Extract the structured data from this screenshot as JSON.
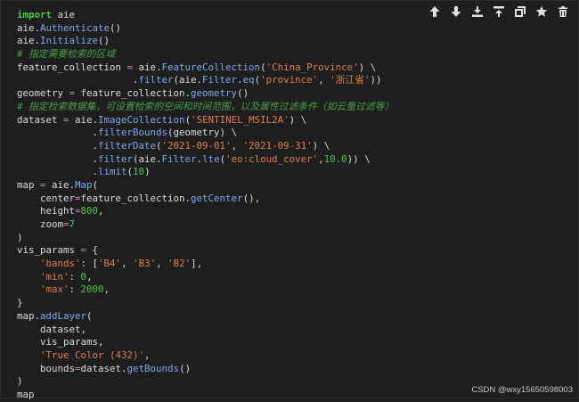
{
  "toolbar": {
    "buttons": [
      {
        "name": "move-up-button",
        "icon": "arrow-up-icon"
      },
      {
        "name": "move-down-button",
        "icon": "arrow-down-icon"
      },
      {
        "name": "insert-above-button",
        "icon": "insert-above-icon"
      },
      {
        "name": "insert-below-button",
        "icon": "insert-below-icon"
      },
      {
        "name": "duplicate-button",
        "icon": "duplicate-icon"
      },
      {
        "name": "bookmark-button",
        "icon": "star-icon"
      },
      {
        "name": "delete-button",
        "icon": "trash-icon"
      }
    ]
  },
  "code": {
    "lines": [
      [
        [
          "kw",
          "import"
        ],
        [
          "nm",
          " aie"
        ]
      ],
      [
        [
          "nm",
          "aie."
        ],
        [
          "at",
          "Authenticate"
        ],
        [
          "nm",
          "()"
        ]
      ],
      [
        [
          "nm",
          "aie."
        ],
        [
          "at",
          "Initialize"
        ],
        [
          "nm",
          "()"
        ]
      ],
      [
        [
          "cm",
          "# 指定需要检索的区域"
        ]
      ],
      [
        [
          "nm",
          "feature_collection "
        ],
        [
          "op",
          "="
        ],
        [
          "nm",
          " aie."
        ],
        [
          "at",
          "FeatureCollection"
        ],
        [
          "nm",
          "("
        ],
        [
          "st",
          "'China_Province'"
        ],
        [
          "nm",
          ") \\"
        ]
      ],
      [
        [
          "nm",
          "                    ."
        ],
        [
          "at",
          "filter"
        ],
        [
          "nm",
          "(aie."
        ],
        [
          "at",
          "Filter"
        ],
        [
          "nm",
          "."
        ],
        [
          "at",
          "eq"
        ],
        [
          "nm",
          "("
        ],
        [
          "st",
          "'province'"
        ],
        [
          "nm",
          ", "
        ],
        [
          "st",
          "'浙江省'"
        ],
        [
          "nm",
          "))"
        ]
      ],
      [
        [
          "nm",
          "geometry "
        ],
        [
          "op",
          "="
        ],
        [
          "nm",
          " feature_collection."
        ],
        [
          "at",
          "geometry"
        ],
        [
          "nm",
          "()"
        ]
      ],
      [
        [
          "cm",
          "# 指定检索数据集，可设置检索的空间和时间范围，以及属性过滤条件（如云量过滤等）"
        ]
      ],
      [
        [
          "nm",
          "dataset "
        ],
        [
          "op",
          "="
        ],
        [
          "nm",
          " aie."
        ],
        [
          "at",
          "ImageCollection"
        ],
        [
          "nm",
          "("
        ],
        [
          "st",
          "'SENTINEL_MSIL2A'"
        ],
        [
          "nm",
          ") \\"
        ]
      ],
      [
        [
          "nm",
          "             ."
        ],
        [
          "at",
          "filterBounds"
        ],
        [
          "nm",
          "(geometry) \\"
        ]
      ],
      [
        [
          "nm",
          "             ."
        ],
        [
          "at",
          "filterDate"
        ],
        [
          "nm",
          "("
        ],
        [
          "st",
          "'2021-09-01'"
        ],
        [
          "nm",
          ", "
        ],
        [
          "st",
          "'2021-09-31'"
        ],
        [
          "nm",
          ") \\"
        ]
      ],
      [
        [
          "nm",
          "             ."
        ],
        [
          "at",
          "filter"
        ],
        [
          "nm",
          "(aie."
        ],
        [
          "at",
          "Filter"
        ],
        [
          "nm",
          "."
        ],
        [
          "at",
          "lte"
        ],
        [
          "nm",
          "("
        ],
        [
          "st",
          "'eo:cloud_cover'"
        ],
        [
          "nm",
          ","
        ],
        [
          "nu",
          "10.0"
        ],
        [
          "nm",
          ")) \\"
        ]
      ],
      [
        [
          "nm",
          "             ."
        ],
        [
          "at",
          "limit"
        ],
        [
          "nm",
          "("
        ],
        [
          "nu",
          "10"
        ],
        [
          "nm",
          ")"
        ]
      ],
      [
        [
          "nm",
          "map "
        ],
        [
          "op",
          "="
        ],
        [
          "nm",
          " aie."
        ],
        [
          "at",
          "Map"
        ],
        [
          "nm",
          "("
        ]
      ],
      [
        [
          "nm",
          "    center"
        ],
        [
          "op",
          "="
        ],
        [
          "nm",
          "feature_collection."
        ],
        [
          "at",
          "getCenter"
        ],
        [
          "nm",
          "(),"
        ]
      ],
      [
        [
          "nm",
          "    height"
        ],
        [
          "op",
          "="
        ],
        [
          "nu",
          "800"
        ],
        [
          "nm",
          ","
        ]
      ],
      [
        [
          "nm",
          "    zoom"
        ],
        [
          "op",
          "="
        ],
        [
          "nu",
          "7"
        ]
      ],
      [
        [
          "nm",
          ")"
        ]
      ],
      [
        [
          "nm",
          "vis_params "
        ],
        [
          "op",
          "="
        ],
        [
          "nm",
          " {"
        ]
      ],
      [
        [
          "nm",
          "    "
        ],
        [
          "st",
          "'bands'"
        ],
        [
          "nm",
          ": ["
        ],
        [
          "st",
          "'B4'"
        ],
        [
          "nm",
          ", "
        ],
        [
          "st",
          "'B3'"
        ],
        [
          "nm",
          ", "
        ],
        [
          "st",
          "'B2'"
        ],
        [
          "nm",
          "],"
        ]
      ],
      [
        [
          "nm",
          "    "
        ],
        [
          "st",
          "'min'"
        ],
        [
          "nm",
          ": "
        ],
        [
          "nu",
          "0"
        ],
        [
          "nm",
          ","
        ]
      ],
      [
        [
          "nm",
          "    "
        ],
        [
          "st",
          "'max'"
        ],
        [
          "nm",
          ": "
        ],
        [
          "nu",
          "2000"
        ],
        [
          "nm",
          ","
        ]
      ],
      [
        [
          "nm",
          "}"
        ]
      ],
      [
        [
          "nm",
          "map."
        ],
        [
          "at",
          "addLayer"
        ],
        [
          "nm",
          "("
        ]
      ],
      [
        [
          "nm",
          "    dataset,"
        ]
      ],
      [
        [
          "nm",
          "    vis_params,"
        ]
      ],
      [
        [
          "nm",
          "    "
        ],
        [
          "st",
          "'True Color (432)'"
        ],
        [
          "nm",
          ","
        ]
      ],
      [
        [
          "nm",
          "    bounds"
        ],
        [
          "op",
          "="
        ],
        [
          "nm",
          "dataset."
        ],
        [
          "at",
          "getBounds"
        ],
        [
          "nm",
          "()"
        ]
      ],
      [
        [
          "nm",
          ")"
        ]
      ],
      [
        [
          "nm",
          "map"
        ]
      ]
    ]
  },
  "watermark": "CSDN @wxy15650598003"
}
